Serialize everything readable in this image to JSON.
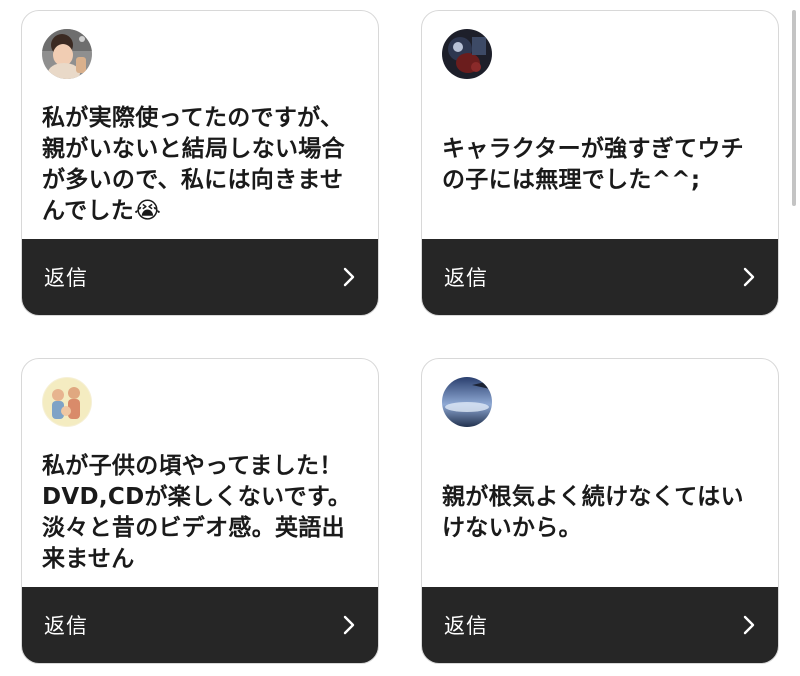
{
  "cards": [
    {
      "avatar": "child-photo-avatar",
      "message": "私が実際使ってたのですが、親がいないと結局しない場合が多いので、私には向きませんでした😭",
      "reply_label": "返信",
      "chevron": "chevron-right-icon"
    },
    {
      "avatar": "dark-photo-avatar",
      "message": "キャラクターが強すぎてウチの子には無理でした^^;",
      "reply_label": "返信",
      "chevron": "chevron-right-icon"
    },
    {
      "avatar": "family-illustration-avatar",
      "message": "私が子供の頃やってました！DVD,CDが楽しくないです。淡々と昔のビデオ感。英語出来ません",
      "reply_label": "返信",
      "chevron": "chevron-right-icon"
    },
    {
      "avatar": "sky-photo-avatar",
      "message": "親が根気よく続けなくてはいけないから。",
      "reply_label": "返信",
      "chevron": "chevron-right-icon"
    }
  ],
  "colors": {
    "card_border": "#d8d8d8",
    "footer_background": "#262626",
    "footer_text": "#ffffff",
    "message_text": "#1a1a1a"
  }
}
